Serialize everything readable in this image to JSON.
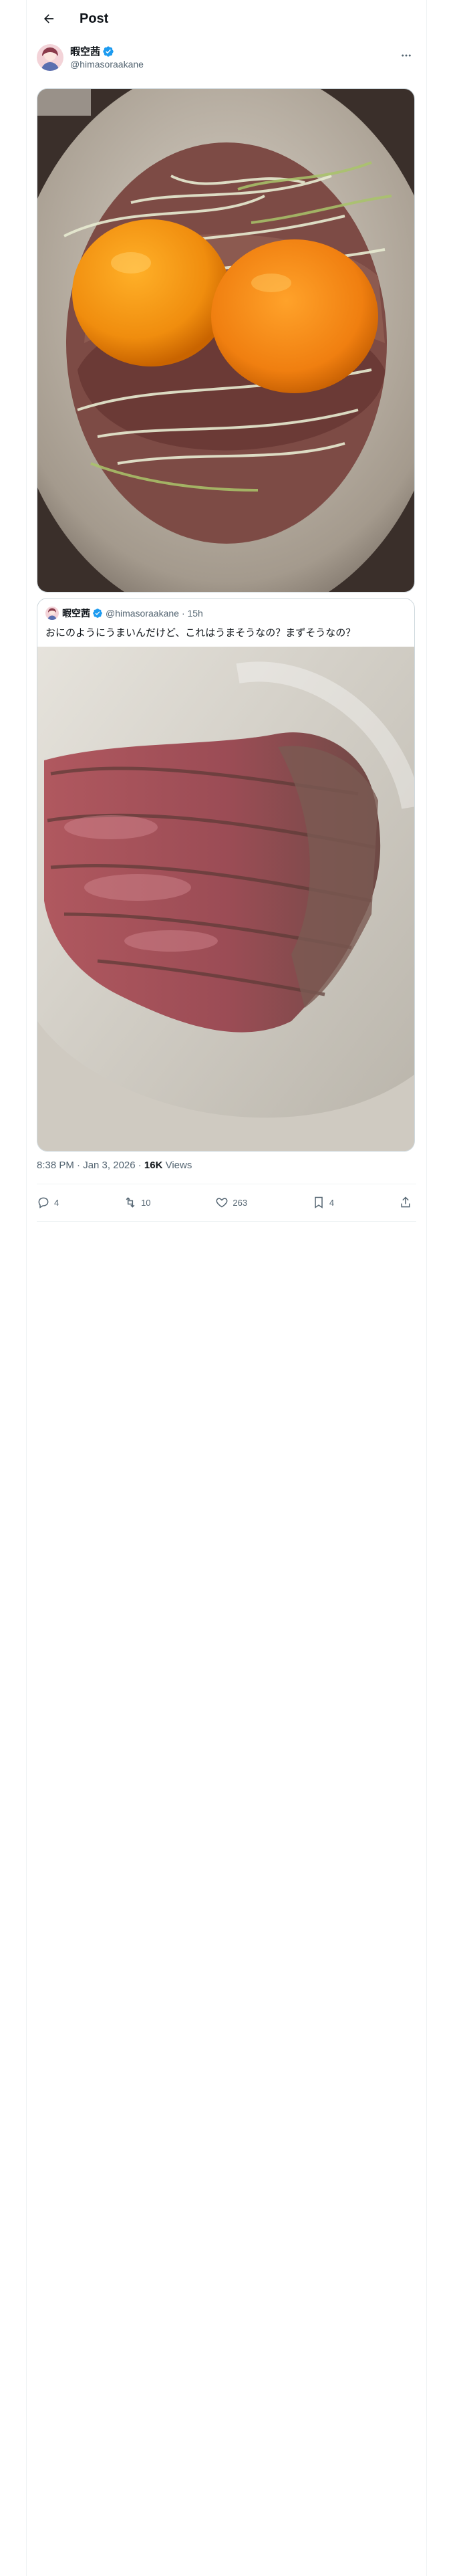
{
  "header": {
    "title": "Post"
  },
  "author": {
    "name": "暇空茜",
    "handle": "@himasoraakane"
  },
  "quote": {
    "name": "暇空茜",
    "handle": "@himasoraakane",
    "age": "· 15h",
    "text": "おにのようにうまいんだけど、これはうまそうなの？まずそうなの？"
  },
  "meta": {
    "time": "8:38 PM · Jan 3, 2026 · ",
    "views_count": "16K",
    "views_label": " Views"
  },
  "actions": {
    "replies": "4",
    "reposts": "10",
    "likes": "263",
    "bookmarks": "4"
  },
  "colors": {
    "accent": "#1d9bf0",
    "muted": "#536471",
    "border": "#cfd9de"
  }
}
